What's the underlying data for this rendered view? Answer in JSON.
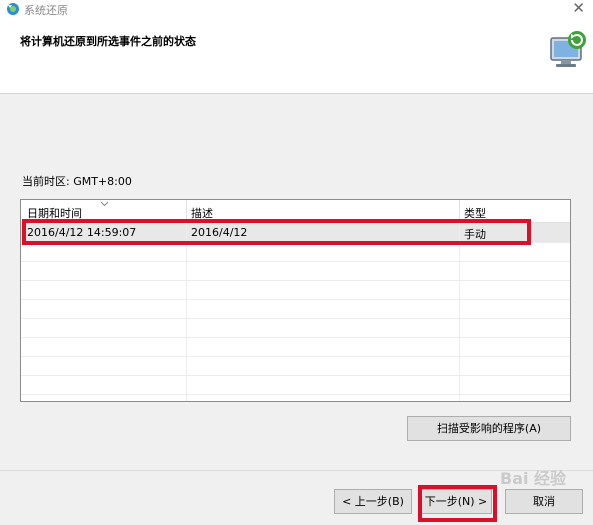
{
  "window": {
    "title": "系统还原",
    "close_glyph": "✕"
  },
  "header": {
    "heading": "将计算机还原到所选事件之前的状态"
  },
  "timezone": {
    "label": "当前时区: GMT+8:00"
  },
  "list": {
    "columns": [
      "日期和时间",
      "描述",
      "类型"
    ],
    "rows": [
      {
        "datetime": "2016/4/12 14:59:07",
        "description": "2016/4/12",
        "type": "手动"
      }
    ]
  },
  "scan_button": {
    "label": "扫描受影响的程序(A)"
  },
  "footer": {
    "back_label": "< 上一步(B)",
    "next_label": "下一步(N) >",
    "cancel_label": "取消"
  },
  "watermark": {
    "text": "Bai 经验"
  },
  "colors": {
    "highlight": "#d8102a",
    "selected_row": "#e8e8e8",
    "button": "#e1e1e1"
  },
  "icons": {
    "app": "system-restore-icon",
    "hero": "computer-restore-icon",
    "close": "close-icon",
    "sort": "chevron-down-icon"
  }
}
